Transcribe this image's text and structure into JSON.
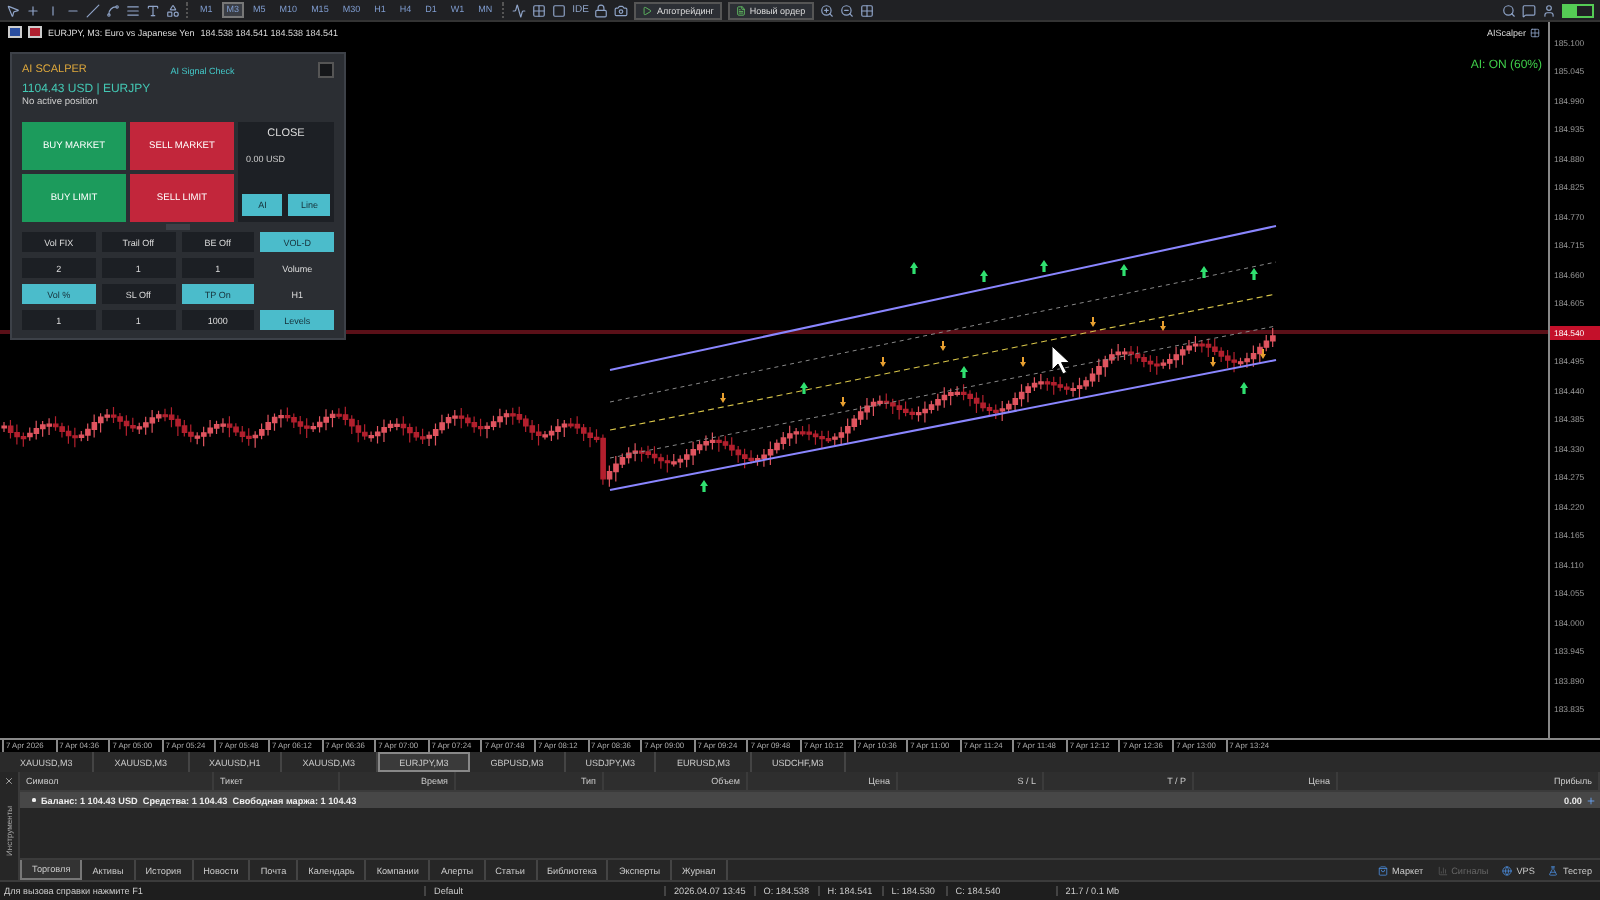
{
  "toolbar": {
    "timeframes": [
      {
        "label": "M1",
        "selected": false
      },
      {
        "label": "M3",
        "selected": true
      },
      {
        "label": "M5",
        "selected": false
      },
      {
        "label": "M10",
        "selected": false
      },
      {
        "label": "M15",
        "selected": false
      },
      {
        "label": "M30",
        "selected": false
      },
      {
        "label": "H1",
        "selected": false
      },
      {
        "label": "H4",
        "selected": false
      },
      {
        "label": "D1",
        "selected": false
      },
      {
        "label": "W1",
        "selected": false
      },
      {
        "label": "MN",
        "selected": false
      }
    ],
    "ide": "IDE",
    "algo_button": "Алготрейдинг",
    "new_order": "Новый ордер"
  },
  "chart": {
    "title": "EURJPY, M3: Euro vs Japanese Yen",
    "ohlc": "184.538 184.541 184.538 184.541",
    "indicator_name": "AIScalper",
    "ai_status": "AI: ON (60%)",
    "price_axis": [
      {
        "text": "185.100",
        "kind": "tick"
      },
      {
        "text": "185.045",
        "kind": "tick"
      },
      {
        "text": "184.990",
        "kind": "tick"
      },
      {
        "text": "184.935",
        "kind": "tick"
      },
      {
        "text": "184.880",
        "kind": "tick"
      },
      {
        "text": "184.825",
        "kind": "tick"
      },
      {
        "text": "184.770",
        "kind": "tick"
      },
      {
        "text": "184.715",
        "kind": "tick"
      },
      {
        "text": "184.660",
        "kind": "tick"
      },
      {
        "text": "184.605",
        "kind": "tick"
      },
      {
        "text": "184.540",
        "kind": "current"
      },
      {
        "text": "184.495",
        "kind": "tick"
      },
      {
        "text": "184.440",
        "kind": "tick"
      },
      {
        "text": "184.385",
        "kind": "tick"
      },
      {
        "text": "184.330",
        "kind": "tick"
      },
      {
        "text": "184.275",
        "kind": "tick"
      },
      {
        "text": "184.220",
        "kind": "tick"
      },
      {
        "text": "184.165",
        "kind": "tick"
      },
      {
        "text": "184.110",
        "kind": "tick"
      },
      {
        "text": "184.055",
        "kind": "tick"
      },
      {
        "text": "184.000",
        "kind": "tick"
      },
      {
        "text": "183.945",
        "kind": "tick"
      },
      {
        "text": "183.890",
        "kind": "tick"
      },
      {
        "text": "183.835",
        "kind": "tick"
      }
    ],
    "time_axis": [
      "7 Apr 2026",
      "7 Apr 04:36",
      "7 Apr 05:00",
      "7 Apr 05:24",
      "7 Apr 05:48",
      "7 Apr 06:12",
      "7 Apr 06:36",
      "7 Apr 07:00",
      "7 Apr 07:24",
      "7 Apr 07:48",
      "7 Apr 08:12",
      "7 Apr 08:36",
      "7 Apr 09:00",
      "7 Apr 09:24",
      "7 Apr 09:48",
      "7 Apr 10:12",
      "7 Apr 10:36",
      "7 Apr 11:00",
      "7 Apr 11:24",
      "7 Apr 11:48",
      "7 Apr 12:12",
      "7 Apr 12:36",
      "7 Apr 13:00",
      "7 Apr 13:24"
    ]
  },
  "panel": {
    "title": "AI SCALPER",
    "signal": "AI Signal Check",
    "account": "1104.43 USD | EURJPY",
    "position": "No active position",
    "trade_buttons": [
      {
        "label": "BUY MARKET",
        "kind": "buy"
      },
      {
        "label": "SELL MARKET",
        "kind": "sell"
      },
      {
        "label": "BUY LIMIT",
        "kind": "buy"
      },
      {
        "label": "SELL LIMIT",
        "kind": "sell"
      }
    ],
    "close": {
      "label": "CLOSE",
      "amount": "0.00 USD",
      "buttons": [
        {
          "label": "AI",
          "on": true
        },
        {
          "label": "Line",
          "on": true
        }
      ]
    },
    "settings": [
      {
        "kind": "toggle",
        "label": "Vol FIX",
        "on": false
      },
      {
        "kind": "toggle",
        "label": "Trail Off",
        "on": false
      },
      {
        "kind": "toggle",
        "label": "BE Off",
        "on": false
      },
      {
        "kind": "toggle",
        "label": "VOL-D",
        "on": true
      },
      {
        "kind": "value",
        "label": "2"
      },
      {
        "kind": "value",
        "label": "1"
      },
      {
        "kind": "value",
        "label": "1"
      },
      {
        "kind": "text",
        "label": "Volume"
      },
      {
        "kind": "toggle",
        "label": "Vol %",
        "on": true
      },
      {
        "kind": "toggle",
        "label": "SL Off",
        "on": false
      },
      {
        "kind": "toggle",
        "label": "TP On",
        "on": true
      },
      {
        "kind": "text",
        "label": "H1"
      },
      {
        "kind": "value",
        "label": "1"
      },
      {
        "kind": "value",
        "label": "1"
      },
      {
        "kind": "value",
        "label": "1000"
      },
      {
        "kind": "toggle",
        "label": "Levels",
        "on": true
      }
    ]
  },
  "symbol_tabs": [
    {
      "label": "XAUUSD,M3",
      "selected": false
    },
    {
      "label": "XAUUSD,M3",
      "selected": false
    },
    {
      "label": "XAUUSD,H1",
      "selected": false
    },
    {
      "label": "XAUUSD,M3",
      "selected": false
    },
    {
      "label": "EURJPY,M3",
      "selected": true
    },
    {
      "label": "GBPUSD,M3",
      "selected": false
    },
    {
      "label": "USDJPY,M3",
      "selected": false
    },
    {
      "label": "EURUSD,M3",
      "selected": false
    },
    {
      "label": "USDCHF,M3",
      "selected": false
    }
  ],
  "side_label": "Инструменты",
  "trade_table": {
    "columns": [
      "Символ",
      "Тикет",
      "Время",
      "Тип",
      "Объем",
      "Цена",
      "S / L",
      "T / P",
      "Цена",
      "Прибыль"
    ],
    "balance": "Баланс: 1 104.43 USD  Средства: 1 104.43  Свободная маржа: 1 104.43",
    "profit": "0.00"
  },
  "bottom_tabs": [
    {
      "label": "Торговля",
      "selected": true
    },
    {
      "label": "Активы",
      "selected": false
    },
    {
      "label": "История",
      "selected": false
    },
    {
      "label": "Новости",
      "selected": false
    },
    {
      "label": "Почта",
      "selected": false
    },
    {
      "label": "Календарь",
      "selected": false
    },
    {
      "label": "Компании",
      "selected": false
    },
    {
      "label": "Алерты",
      "selected": false
    },
    {
      "label": "Статьи",
      "selected": false
    },
    {
      "label": "Библиотека",
      "selected": false
    },
    {
      "label": "Эксперты",
      "selected": false
    },
    {
      "label": "Журнал",
      "selected": false
    }
  ],
  "services": [
    {
      "label": "Маркет",
      "disabled": false
    },
    {
      "label": "Сигналы",
      "disabled": true
    },
    {
      "label": "VPS",
      "disabled": false
    },
    {
      "label": "Тестер",
      "disabled": false
    }
  ],
  "status_bar": {
    "help": "Для вызова справки нажмите F1",
    "profile": "Default",
    "time": "2026.04.07 13:45",
    "open": "O: 184.538",
    "high": "H: 184.541",
    "low": "L: 184.530",
    "close": "C: 184.540",
    "traffic": "21.7 / 0.1 Mb"
  }
}
